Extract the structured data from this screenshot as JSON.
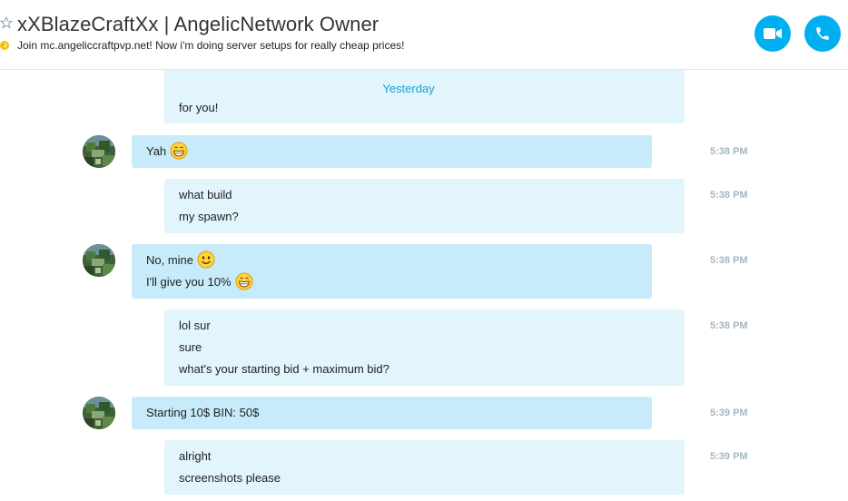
{
  "header": {
    "title": "xXBlazeCraftXx | AngelicNetwork Owner",
    "mood": "Join mc.angeliccraftpvp.net! Now i'm doing server setups for really cheap prices!",
    "icons": {
      "star": "star-icon",
      "mood": "clock-icon",
      "video": "video-camera-icon",
      "audio": "phone-icon"
    },
    "accent_color": "#00aff0"
  },
  "chat": {
    "date_separator": "Yesterday",
    "partial_top_text": "for you!",
    "messages": [
      {
        "from": "contact",
        "lines": [
          {
            "text": "Yah",
            "emoji": "grin"
          }
        ],
        "time": "5:38 PM"
      },
      {
        "from": "me",
        "lines": [
          {
            "text": "what build"
          },
          {
            "text": "my spawn?"
          }
        ],
        "time": "5:38 PM"
      },
      {
        "from": "contact",
        "lines": [
          {
            "text": "No, mine",
            "emoji": "smile"
          },
          {
            "text": "I'll give you 10%",
            "emoji": "grin"
          }
        ],
        "time": "5:38 PM"
      },
      {
        "from": "me",
        "lines": [
          {
            "text": "lol sur"
          },
          {
            "text": "sure"
          },
          {
            "text": "what's your starting bid + maximum bid?"
          }
        ],
        "time": "5:38 PM"
      },
      {
        "from": "contact",
        "lines": [
          {
            "text": "Starting 10$ BIN: 50$"
          }
        ],
        "time": "5:39 PM"
      },
      {
        "from": "me",
        "lines": [
          {
            "text": "alright"
          },
          {
            "text": "screenshots please"
          }
        ],
        "time": "5:39 PM"
      }
    ]
  }
}
